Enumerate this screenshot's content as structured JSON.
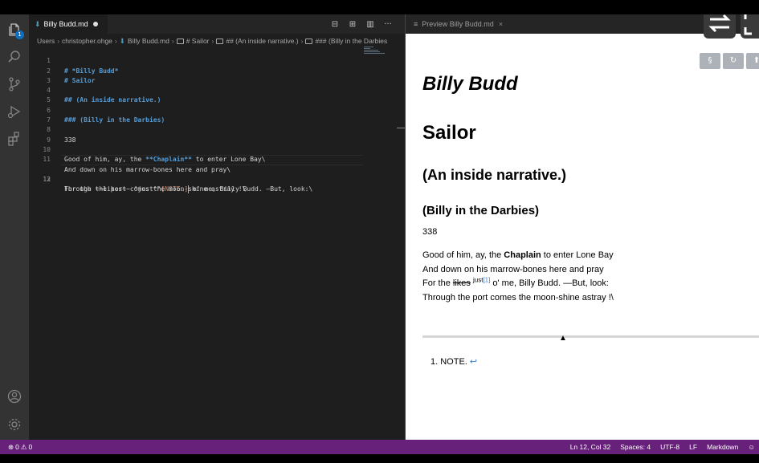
{
  "editor": {
    "tab": {
      "name": "Billy Budd.md"
    },
    "actions": [
      "⊟",
      "⊞",
      "▥",
      "···"
    ],
    "breadcrumb": [
      "Users",
      "christopher.ohge",
      "Billy Budd.md",
      "# Sailor",
      "## (An inside narrative.)",
      "### (Billy in the Darbies"
    ],
    "lines": [
      {
        "n": "1",
        "text": "# *Billy Budd*"
      },
      {
        "n": "2",
        "text": "# Sailor"
      },
      {
        "n": "3",
        "text": ""
      },
      {
        "n": "4",
        "text": "## (An inside narrative.)"
      },
      {
        "n": "5",
        "text": ""
      },
      {
        "n": "6",
        "text": "### (Billy in the Darbies)"
      },
      {
        "n": "7",
        "text": ""
      },
      {
        "n": "8",
        "text": "338"
      },
      {
        "n": "9",
        "text": ""
      },
      {
        "n": "10",
        "pre": "Good of him, ay, the ",
        "bold": "**Chaplain**",
        "post": " to enter Lone Bay\\"
      },
      {
        "n": "11",
        "text": "And down on his marrow-bones here and pray\\"
      },
      {
        "n": "12",
        "pre": "For the ~~likes~~ ^just^^",
        "note": "[NOTE.]",
        "post": " o' me, Billy Budd. —But, look:\\"
      },
      {
        "n": "13",
        "text": "Through the port comes the moon-shine astray !\\"
      }
    ]
  },
  "preview": {
    "tab": {
      "name": "Preview Billy Budd.md"
    },
    "buttons": [
      "§",
      "↻",
      "⬆"
    ],
    "h1": "Billy Budd",
    "h2": "Sailor",
    "h3": "(An inside narrative.)",
    "h4": "(Billy in the Darbies)",
    "number": "338",
    "verse": {
      "l1_pre": "Good of him, ay, the ",
      "l1_bold": "Chaplain",
      "l1_post": " to enter Lone Bay",
      "l2": "And down on his marrow-bones here and pray",
      "l3_pre": "For the ",
      "l3_strike": "likes",
      "l3_sup": "just",
      "l3_ref": "[1]",
      "l3_post": " o' me, Billy Budd. —But, look:",
      "l4": "Through the port comes the moon-shine astray !\\"
    },
    "footnote": {
      "text": "1. NOTE.",
      "back": "↩"
    }
  },
  "statusbar": {
    "errors": "0",
    "warnings": "0",
    "position": "Ln 12, Col 32",
    "spaces": "Spaces: 4",
    "encoding": "UTF-8",
    "eol": "LF",
    "language": "Markdown"
  },
  "colors": {
    "statusbar": "#68217a",
    "accent_badge": "#0e70c0",
    "heading": "#569cd6"
  }
}
